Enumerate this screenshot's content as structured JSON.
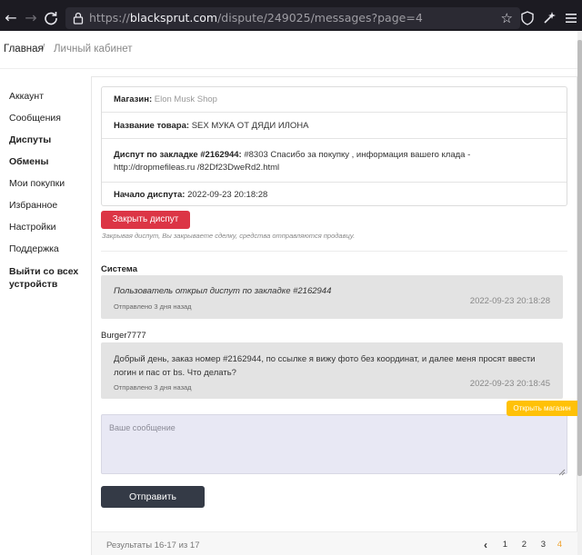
{
  "browser": {
    "url_prefix": "https://",
    "url_host": "blacksprut.com",
    "url_path": "/dispute/249025/messages?page=4"
  },
  "breadcrumb": {
    "home": "Главная",
    "separator": "/",
    "current": "Личный кабинет"
  },
  "sidebar": {
    "items": [
      {
        "label": "Аккаунт",
        "bold": false
      },
      {
        "label": "Сообщения",
        "bold": false
      },
      {
        "label": "Диспуты",
        "bold": true
      },
      {
        "label": "Обмены",
        "bold": true
      },
      {
        "label": "Мои покупки",
        "bold": false
      },
      {
        "label": "Избранное",
        "bold": false
      },
      {
        "label": "Настройки",
        "bold": false
      },
      {
        "label": "Поддержка",
        "bold": false
      },
      {
        "label": "Выйти со всех устройств",
        "bold": true
      }
    ]
  },
  "dispute": {
    "shop_label": "Магазин:",
    "shop_value": "Elon Musk Shop",
    "product_label": "Название товара:",
    "product_value": "SEX МУКА ОТ ДЯДИ ИЛОНА",
    "dispute_label": "Диспут по закладке #2162944:",
    "dispute_value": "#8303 Спасибо за покупку , информация вашего клада - http://dropmefileas.ru /82Df23DweRd2.html",
    "start_label": "Начало диспута:",
    "start_value": "2022-09-23 20:18:28"
  },
  "close_button": "Закрыть диспут",
  "close_hint": "Закрывая диспут, Вы закрываете сделку, средства отправляются продавцу.",
  "messages": [
    {
      "sender": "Система",
      "text": "Пользователь открыл диспут по закладке #2162944",
      "date": "2022-09-23 20:18:28",
      "sent": "Отправлено 3 дня назад"
    },
    {
      "sender": "Burger7777",
      "text": "Добрый день, заказ номер #2162944, по ссылке я вижу фото без координат, и далее меня просят ввести логин и пас от bs. Что делать?",
      "date": "2022-09-23 20:18:45",
      "sent": "Отправлено 3 дня назад"
    }
  ],
  "open_shop_button": "Открыть магазин",
  "message_placeholder": "Ваше сообщение",
  "send_button": "Отправить",
  "footer": {
    "results": "Результаты 16-17 из 17",
    "pages": [
      "1",
      "2",
      "3",
      "4"
    ],
    "current_page": "4"
  }
}
